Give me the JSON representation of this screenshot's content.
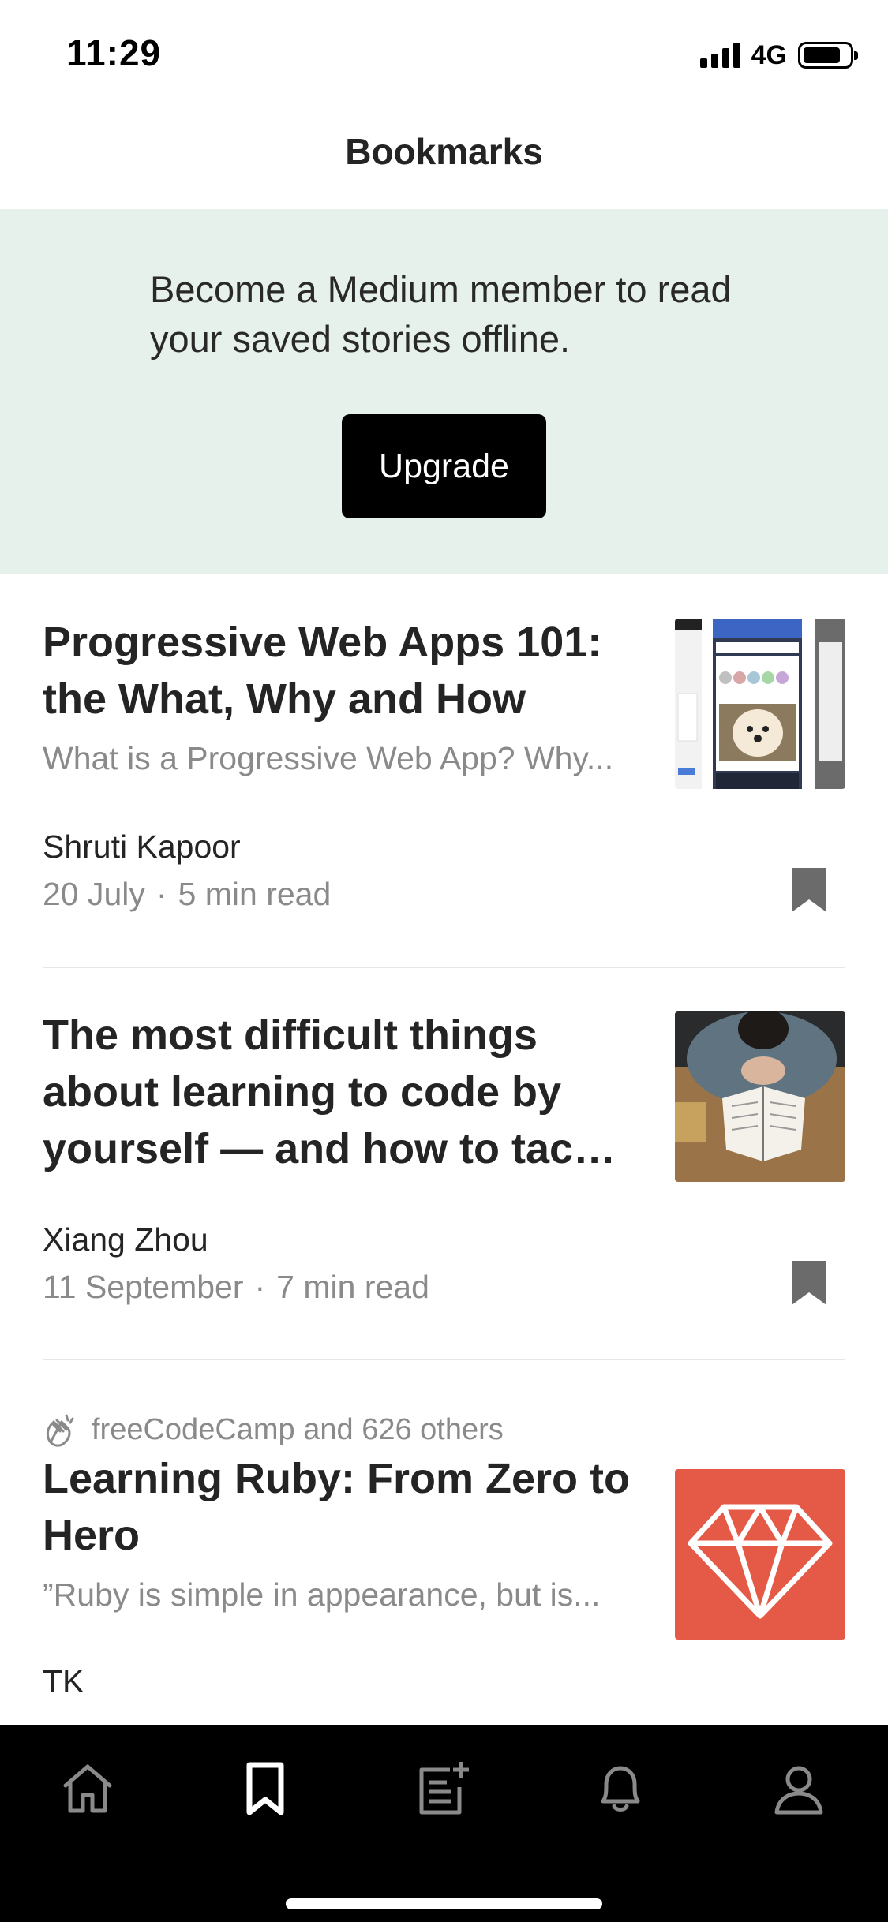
{
  "status_bar": {
    "time": "11:29",
    "network": "4G"
  },
  "header": {
    "title": "Bookmarks"
  },
  "banner": {
    "line1": "Become a Medium member to read",
    "line2": "your saved stories offline.",
    "upgrade_label": "Upgrade"
  },
  "stories": [
    {
      "title_line1": "Progressive Web Apps 101:",
      "title_line2": "the What, Why and How",
      "subtitle": "What is a Progressive Web App? Why...",
      "author": "Shruti Kapoor",
      "date": "20 July",
      "read_time": "5 min read",
      "separator": "·"
    },
    {
      "title_line1": "The most difficult things",
      "title_line2": "about learning to code by",
      "title_line3": "yourself — and how to tack...",
      "author": "Xiang Zhou",
      "date": "11 September",
      "read_time": "7 min read",
      "separator": "·"
    },
    {
      "social": "freeCodeCamp and 626 others",
      "title_line1": "Learning Ruby: From Zero to",
      "title_line2": "Hero",
      "subtitle": "”Ruby is simple in appearance, but is...",
      "author": "TK"
    }
  ],
  "tabs": [
    "home-icon",
    "bookmarks-icon",
    "new-story-icon",
    "notifications-icon",
    "profile-icon"
  ],
  "colors": {
    "banner_bg": "#e7f1eb",
    "ruby_red": "#e55a47",
    "tab_bar_bg": "#000000",
    "muted_text": "#8a8a8a"
  }
}
